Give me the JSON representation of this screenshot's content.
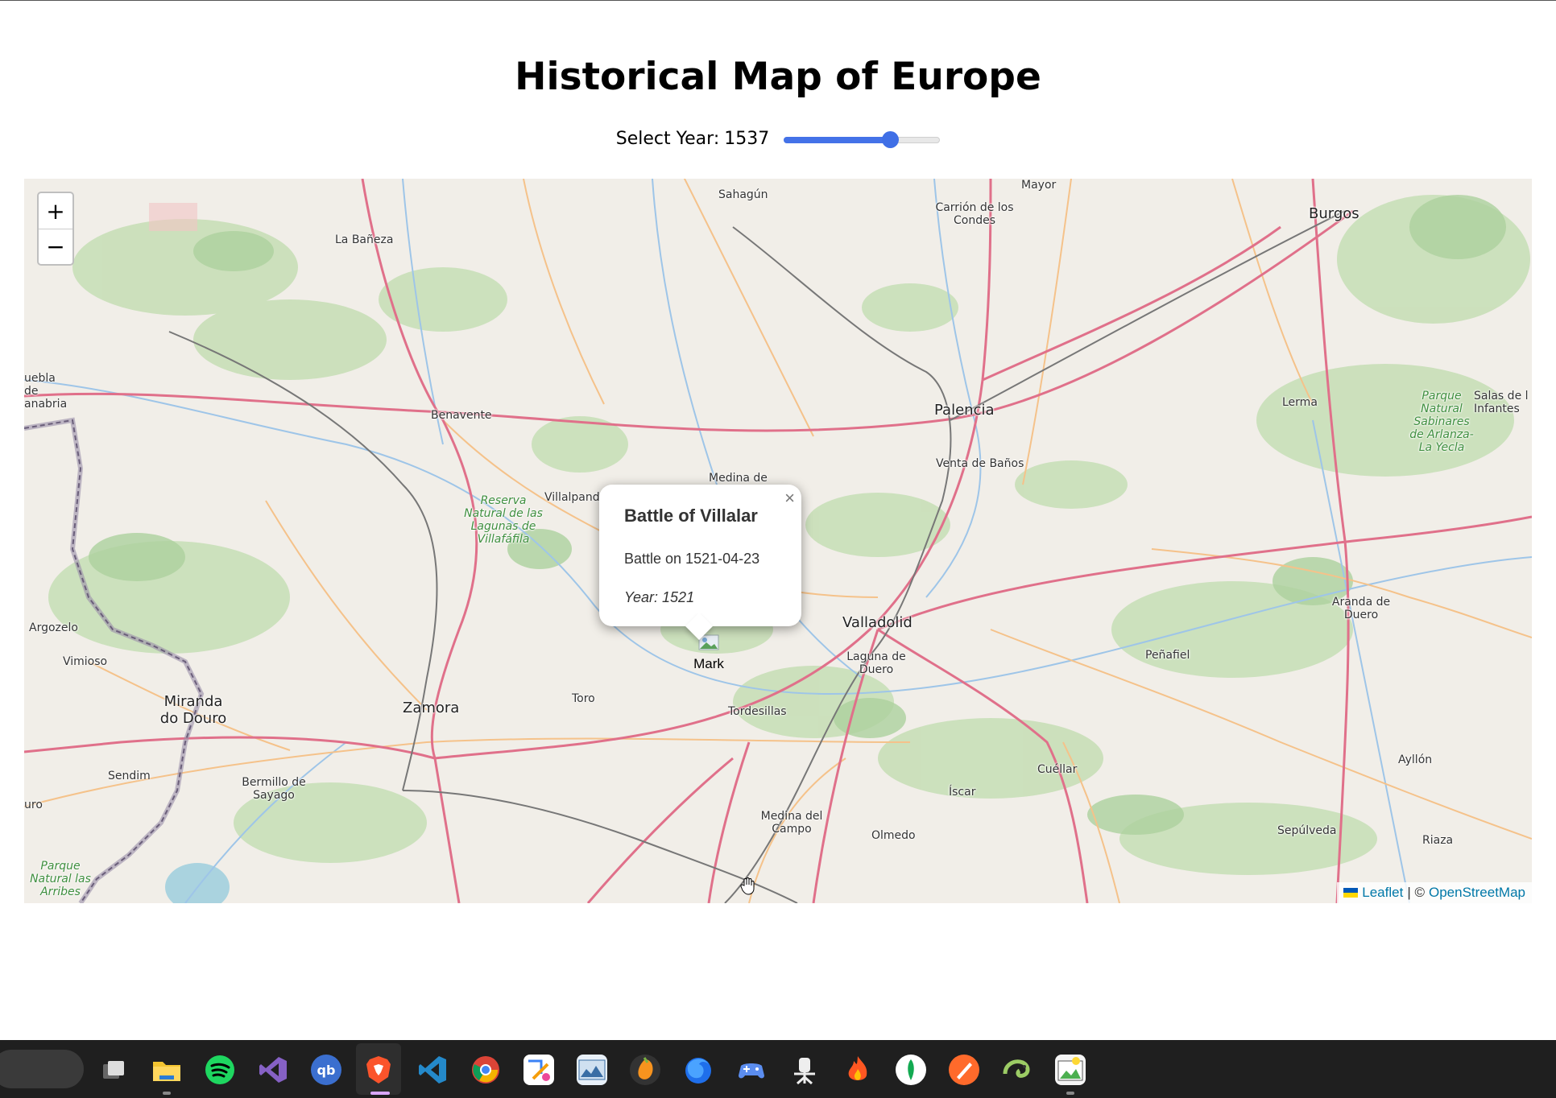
{
  "page": {
    "title": "Historical Map of Europe",
    "year_label": "Select Year:",
    "year_value": "1537",
    "year_slider_fraction": 0.68
  },
  "map": {
    "zoom_in": "+",
    "zoom_out": "−",
    "places": {
      "sahagun": "Sahagún",
      "mayor": "Mayor",
      "carrion": "Carrión de los Condes",
      "burgos": "Burgos",
      "la_baneza": "La Bañeza",
      "puebla": "uebla de anabria",
      "benavente": "Benavente",
      "palencia": "Palencia",
      "lerma": "Lerma",
      "salas": "Salas de l Infantes",
      "parque_sabinares": "Parque Natural Sabinares de Arlanza-La Yecla",
      "venta_banos": "Venta de Baños",
      "medina_rioseco": "Medina de",
      "villalpando": "Villalpand",
      "reserva": "Reserva Natural de las Lagunas de Villafáfila",
      "valladolid": "Valladolid",
      "laguna_duero": "Laguna de Duero",
      "aranda": "Aranda de Duero",
      "penafiel": "Peñafiel",
      "argozelo": "Argozelo",
      "vimioso": "Vimioso",
      "miranda": "Miranda do Douro",
      "zamora": "Zamora",
      "toro": "Toro",
      "tordesillas": "Tordesillas",
      "sendim": "Sendim",
      "bermillo": "Bermillo de Sayago",
      "cuellar": "Cuéllar",
      "ayllon": "Ayllón",
      "iscar": "Íscar",
      "medina_campo": "Medina del Campo",
      "olmedo": "Olmedo",
      "sepulveda": "Sepúlveda",
      "riaza": "Riaza",
      "uro": "uro",
      "parque_arribes": "Parque Natural las Arribes"
    },
    "popup": {
      "close": "×",
      "title": "Battle of Villalar",
      "description": "Battle on 1521-04-23",
      "year_label": "Year:",
      "year_value": "1521"
    },
    "marker_label": "Mark",
    "attribution": {
      "leaflet": "Leaflet",
      "separator": "| ©",
      "osm": "OpenStreetMap"
    },
    "colors": {
      "land": "#f1eee8",
      "forest": "#add19e",
      "major_road": "#e8889a",
      "secondary_road": "#f5c28a",
      "river": "#9ec5e8",
      "rail": "#777777",
      "border": "#9a8ea8"
    }
  },
  "taskbar": {
    "apps": [
      "task-view",
      "file-explorer",
      "spotify",
      "visual-studio",
      "qbittorrent",
      "brave",
      "vscode",
      "chrome",
      "paint",
      "photos",
      "fl-studio",
      "firefox",
      "game-controller",
      "android-tool",
      "fire-app",
      "mongodb",
      "pen-tool",
      "chameleon",
      "image-editor"
    ],
    "qb_text": "qb"
  }
}
